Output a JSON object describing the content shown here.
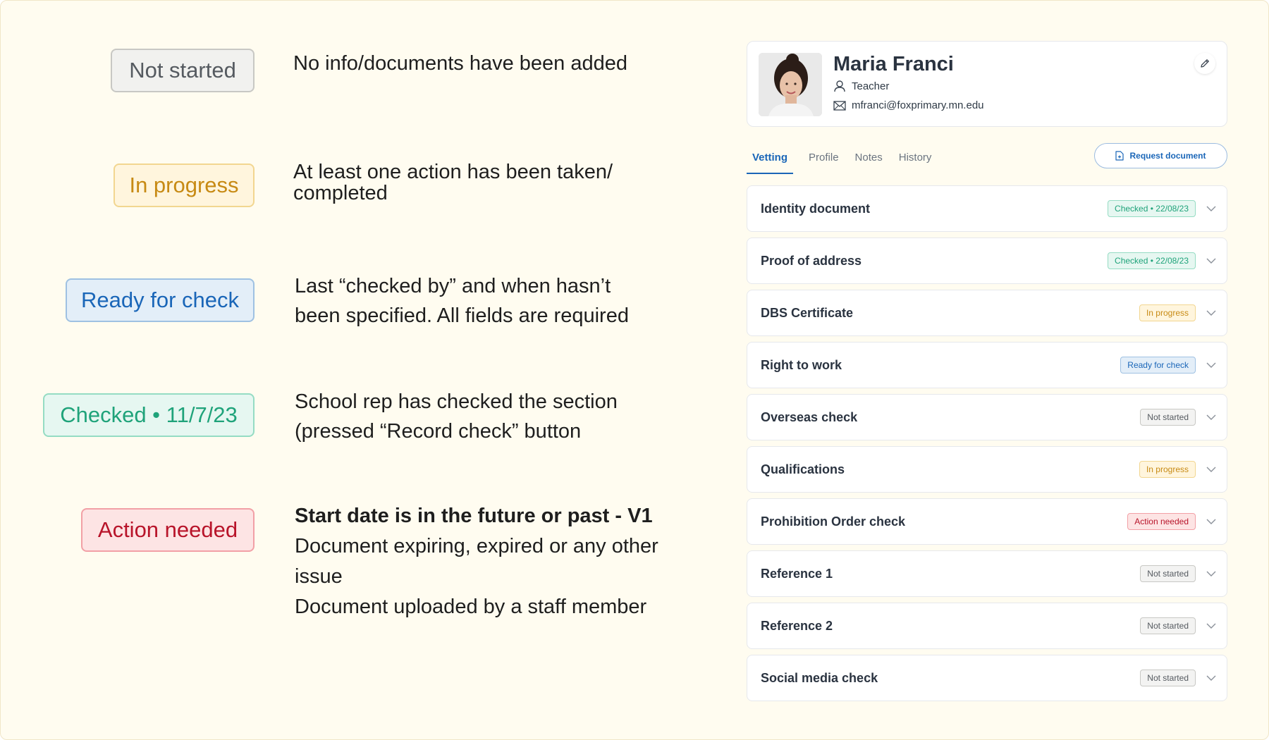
{
  "legend": [
    {
      "badge": "Not started",
      "desc": "No info/documents have been added"
    },
    {
      "badge": "In progress",
      "desc": "At least one action has been taken/ completed"
    },
    {
      "badge": "Ready for check",
      "desc": "Last “checked by” and when hasn’t been specified. All fields are required"
    },
    {
      "badge": "Checked • 11/7/23",
      "desc": "School rep has checked the section (pressed “Record check” button"
    },
    {
      "badge": "Action needed",
      "desc_bold": "Start date is in the future  or past - V1",
      "desc_lines": [
        "Document expiring, expired or any other issue",
        "Document uploaded by a staff member"
      ]
    }
  ],
  "profile": {
    "name": "Maria Franci",
    "role": "Teacher",
    "email": "mfranci@foxprimary.mn.edu",
    "avatar_icon": "person-photo",
    "edit_icon": "pencil-icon"
  },
  "tabs": [
    {
      "label": "Vetting",
      "active": true
    },
    {
      "label": "Profile",
      "active": false
    },
    {
      "label": "Notes",
      "active": false
    },
    {
      "label": "History",
      "active": false
    }
  ],
  "request_button": {
    "label": "Request document",
    "icon": "document-plus-icon"
  },
  "sections": [
    {
      "title": "Identity document",
      "status": "Checked • 22/08/23",
      "kind": "checked"
    },
    {
      "title": "Proof of address",
      "status": "Checked • 22/08/23",
      "kind": "checked"
    },
    {
      "title": "DBS Certificate",
      "status": "In progress",
      "kind": "progress"
    },
    {
      "title": "Right to work",
      "status": "Ready for check",
      "kind": "ready"
    },
    {
      "title": "Overseas check",
      "status": "Not started",
      "kind": "not"
    },
    {
      "title": "Qualifications",
      "status": "In progress",
      "kind": "progress"
    },
    {
      "title": "Prohibition Order check",
      "status": "Action needed",
      "kind": "action"
    },
    {
      "title": "Reference 1",
      "status": "Not started",
      "kind": "not"
    },
    {
      "title": "Reference 2",
      "status": "Not started",
      "kind": "not"
    },
    {
      "title": "Social media check",
      "status": "Not started",
      "kind": "not"
    }
  ],
  "colors": {
    "background": "#fffcf0",
    "accent": "#1a66b8",
    "checked": "#1fa37a",
    "progress": "#c78a14",
    "action": "#b8142a"
  }
}
